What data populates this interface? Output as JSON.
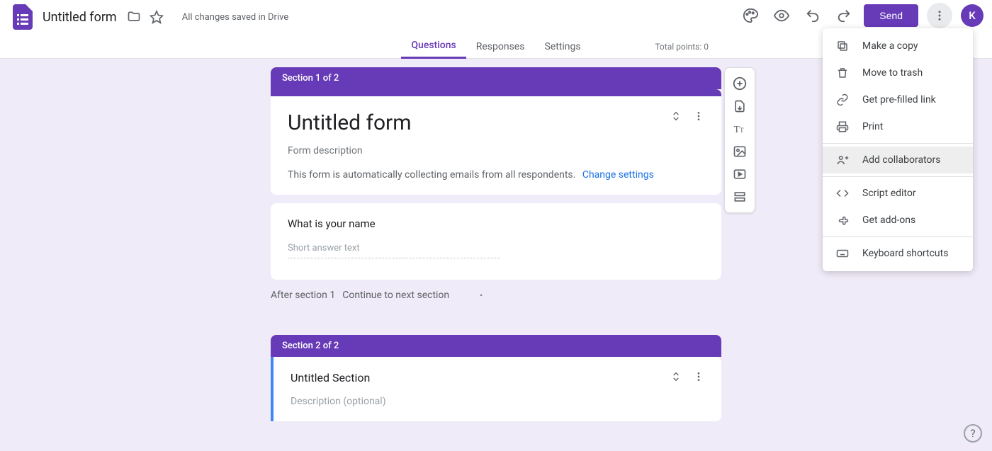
{
  "header": {
    "form_title": "Untitled form",
    "save_status": "All changes saved in Drive",
    "send_label": "Send",
    "avatar_initial": "K"
  },
  "tabs": {
    "questions": "Questions",
    "responses": "Responses",
    "settings": "Settings",
    "total_points": "Total points: 0"
  },
  "section1": {
    "tab_label": "Section 1 of 2",
    "title": "Untitled form",
    "description": "Form description",
    "email_note": "This form is automatically collecting emails from all respondents.",
    "change_settings": "Change settings"
  },
  "question1": {
    "text": "What is your name",
    "answer_type": "Short answer text"
  },
  "after_section": {
    "label": "After section 1",
    "action": "Continue to next section"
  },
  "section2": {
    "tab_label": "Section 2 of 2",
    "title": "Untitled Section",
    "description": "Description (optional)"
  },
  "menu": {
    "copy": "Make a copy",
    "trash": "Move to trash",
    "prefilled": "Get pre-filled link",
    "print": "Print",
    "collaborators": "Add collaborators",
    "script": "Script editor",
    "addons": "Get add-ons",
    "shortcuts": "Keyboard shortcuts"
  }
}
